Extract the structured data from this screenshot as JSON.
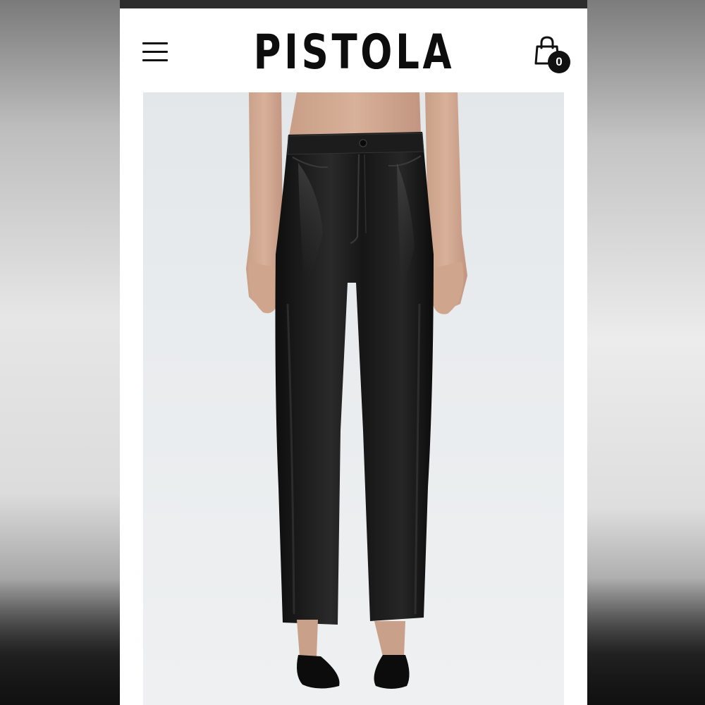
{
  "header": {
    "brand": "PISTOLA",
    "cart_count": "0"
  },
  "icons": {
    "menu": "hamburger-menu-icon",
    "cart": "shopping-bag-icon"
  },
  "product": {
    "image": "black-faux-leather-straight-leg-pants"
  },
  "colors": {
    "status_bar": "#2c2c2c",
    "brand": "#0d0d0d",
    "badge": "#111111",
    "image_bg": "#e6e9ec",
    "pants": "#141414"
  }
}
